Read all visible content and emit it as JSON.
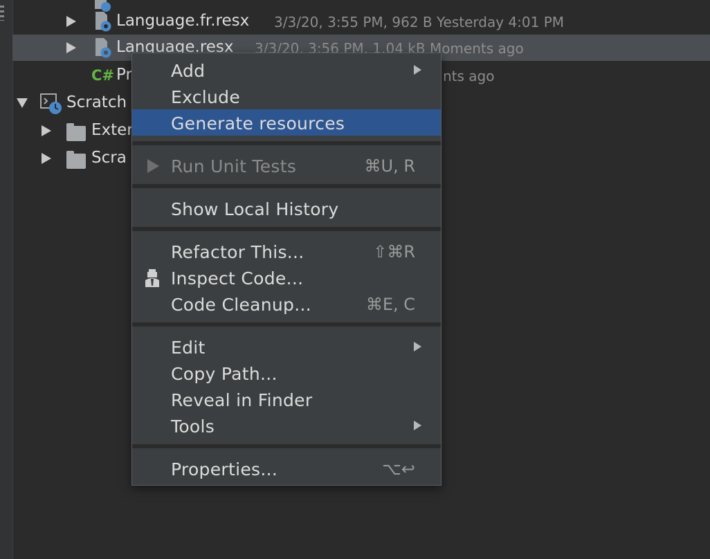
{
  "tree": {
    "rows": [
      {
        "name": "Language.fr.resx",
        "meta": "3/3/20, 3:55 PM, 962 B Yesterday 4:01 PM"
      },
      {
        "name": "Language.resx",
        "meta": "3/3/20, 3:56 PM, 1.04 kB Moments ago"
      },
      {
        "name": "Pr",
        "meta": "nts ago",
        "badge": "C#"
      },
      {
        "name": "Scratch"
      },
      {
        "name": "Exter"
      },
      {
        "name": "Scra"
      }
    ]
  },
  "menu": {
    "items": [
      {
        "label": "Add"
      },
      {
        "label": "Exclude"
      },
      {
        "label": "Generate resources"
      },
      {
        "label": "Run Unit Tests",
        "shortcut": "⌘U, R"
      },
      {
        "label": "Show Local History"
      },
      {
        "label": "Refactor This...",
        "shortcut": "⇧⌘R"
      },
      {
        "label": "Inspect Code..."
      },
      {
        "label": "Code Cleanup...",
        "shortcut": "⌘E, C"
      },
      {
        "label": "Edit"
      },
      {
        "label": "Copy Path..."
      },
      {
        "label": "Reveal in Finder"
      },
      {
        "label": "Tools"
      },
      {
        "label": "Properties...",
        "shortcut": "⌥↩"
      }
    ]
  },
  "colors": {
    "background": "#2b2b2b",
    "menu_background": "#3c3f41",
    "menu_highlight": "#2d5590",
    "selected_row": "#4b4f53",
    "csharp_badge": "#62b543"
  },
  "icons": [
    "resx-file-icon",
    "csharp-file-icon",
    "scratches-icon",
    "folder-icon",
    "run-icon",
    "inspect-code-icon",
    "submenu-arrow-icon"
  ]
}
